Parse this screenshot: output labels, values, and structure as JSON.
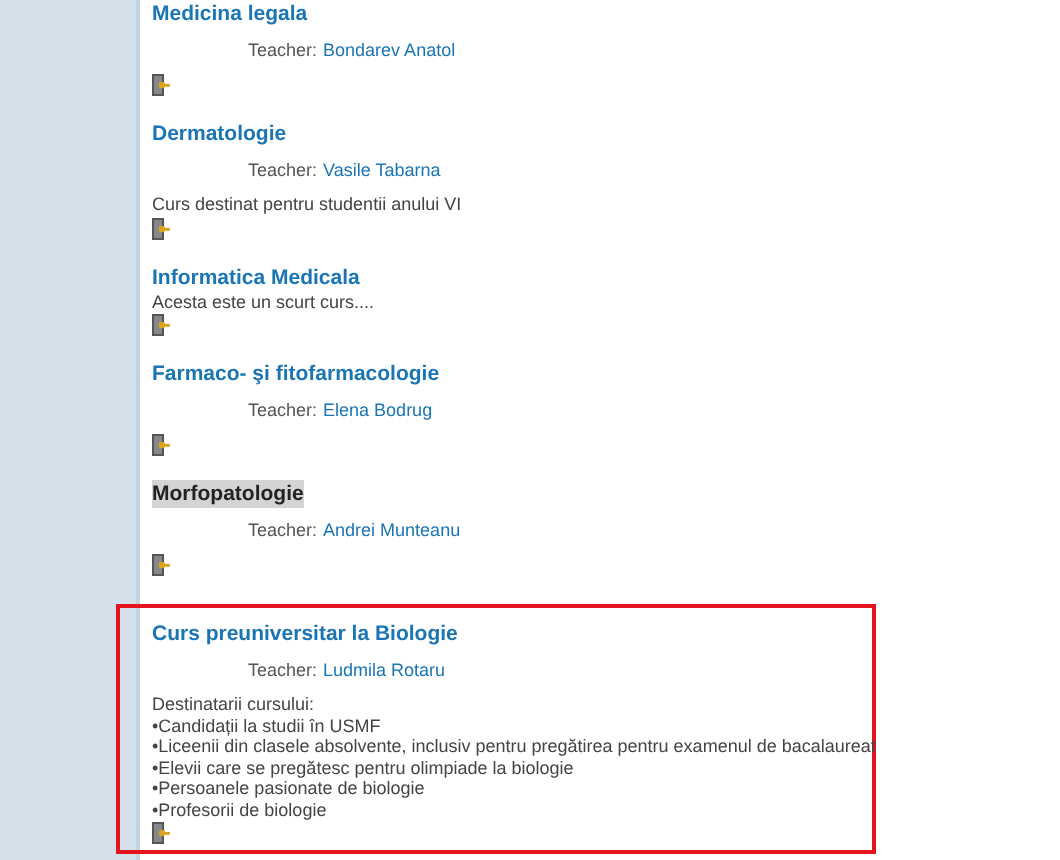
{
  "courses": [
    {
      "title": "Medicina legala",
      "teacher_label": "Teacher:",
      "teacher": "Bondarev Anatol",
      "highlighted": false,
      "outlined": false
    },
    {
      "title": "Dermatologie",
      "teacher_label": "Teacher:",
      "teacher": "Vasile Tabarna",
      "description": [
        "Curs destinat pentru studentii anului VI"
      ],
      "highlighted": false,
      "outlined": false
    },
    {
      "title": "Informatica Medicala",
      "description": [
        "Acesta este un scurt curs...."
      ],
      "highlighted": false,
      "outlined": false
    },
    {
      "title": "Farmaco- şi fitofarmacologie",
      "teacher_label": "Teacher:",
      "teacher": "Elena Bodrug",
      "highlighted": false,
      "outlined": false
    },
    {
      "title": "Morfopatologie",
      "teacher_label": "Teacher:",
      "teacher": "Andrei Munteanu",
      "highlighted": true,
      "outlined": false
    },
    {
      "title": "Curs preuniversitar la Biologie",
      "teacher_label": "Teacher:",
      "teacher": "Ludmila Rotaru",
      "description": [
        "Destinatarii cursului:",
        "•Candidații la studii în USMF",
        "•Liceenii din clasele absolvente, inclusiv pentru pregătirea pentru examenul de bacalaureat",
        "•Elevii care se pregătesc pentru olimpiade la biologie",
        "•Persoanele pasionate de biologie",
        "•Profesorii de biologie"
      ],
      "highlighted": false,
      "outlined": true
    }
  ]
}
